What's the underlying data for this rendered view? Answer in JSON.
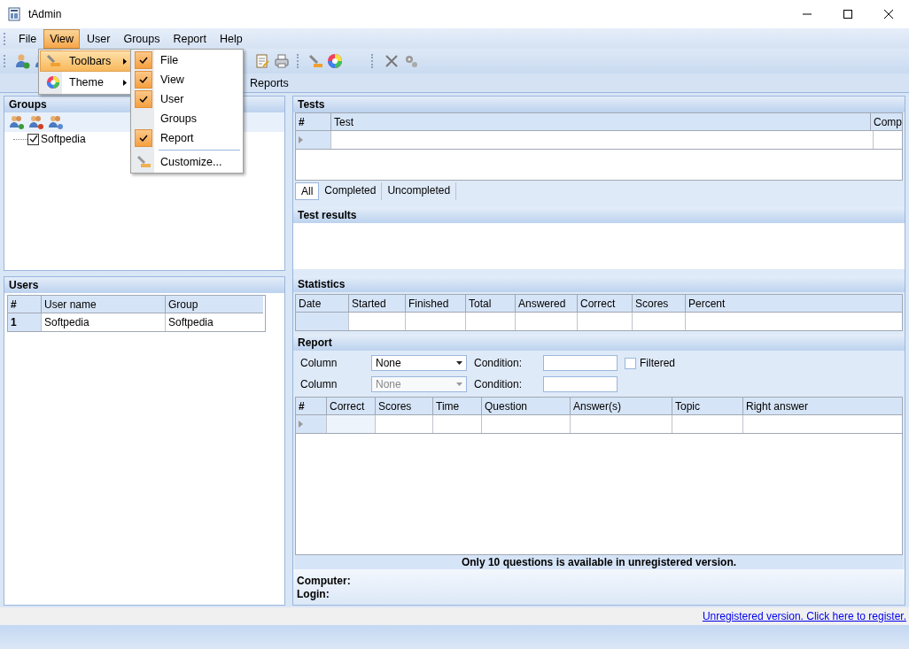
{
  "window": {
    "title": "tAdmin"
  },
  "menu_bar": [
    {
      "label": "File",
      "selected": false
    },
    {
      "label": "View",
      "selected": true
    },
    {
      "label": "User",
      "selected": false
    },
    {
      "label": "Groups",
      "selected": false
    },
    {
      "label": "Report",
      "selected": false
    },
    {
      "label": "Help",
      "selected": false
    }
  ],
  "view_menu": [
    {
      "label": "Toolbars",
      "selected": true,
      "kind": "submenu"
    },
    {
      "label": "Theme",
      "selected": false,
      "kind": "submenu"
    }
  ],
  "toolbars_submenu": [
    {
      "label": "File",
      "kind": "toggle",
      "checked": true
    },
    {
      "label": "View",
      "kind": "toggle",
      "checked": true
    },
    {
      "label": "User",
      "kind": "toggle",
      "checked": true
    },
    {
      "label": "Groups",
      "kind": "toggle",
      "checked": false
    },
    {
      "label": "Report",
      "kind": "toggle",
      "checked": true
    },
    {
      "label": "Customize...",
      "kind": "command"
    }
  ],
  "tabs": [
    {
      "label": "Reports",
      "selected": false
    }
  ],
  "groups_panel": {
    "title": "Groups",
    "tree": [
      {
        "label": "Softpedia",
        "checked": true
      }
    ]
  },
  "users_panel": {
    "title": "Users",
    "columns": [
      "#",
      "User name",
      "Group"
    ],
    "rows": [
      [
        "1",
        "Softpedia",
        "Softpedia"
      ]
    ]
  },
  "tests_panel": {
    "title": "Tests",
    "columns": [
      "#",
      "Test",
      "Comp"
    ],
    "filter_tabs": [
      {
        "label": "All",
        "selected": true
      },
      {
        "label": "Completed",
        "selected": false
      },
      {
        "label": "Uncompleted",
        "selected": false
      }
    ]
  },
  "test_results": {
    "title": "Test results"
  },
  "statistics": {
    "title": "Statistics",
    "columns": [
      "Date",
      "Started",
      "Finished",
      "Total",
      "Answered",
      "Correct",
      "Scores",
      "Percent"
    ]
  },
  "report": {
    "title": "Report",
    "filters": [
      {
        "label": "Column",
        "value": "None",
        "disabled": false,
        "condition_label": "Condition:",
        "filtered": {
          "label": "Filtered",
          "checked": false
        }
      },
      {
        "label": "Column",
        "value": "None",
        "disabled": true,
        "condition_label": "Condition:"
      }
    ],
    "columns": [
      "#",
      "Correct",
      "Scores",
      "Time",
      "Question",
      "Answer(s)",
      "Topic",
      "Right answer"
    ],
    "notice": "Only 10 questions is available in unregistered version.",
    "info": [
      "Computer:",
      "Login:"
    ]
  },
  "status_bar": {
    "link": "Unregistered version. Click here to register."
  }
}
